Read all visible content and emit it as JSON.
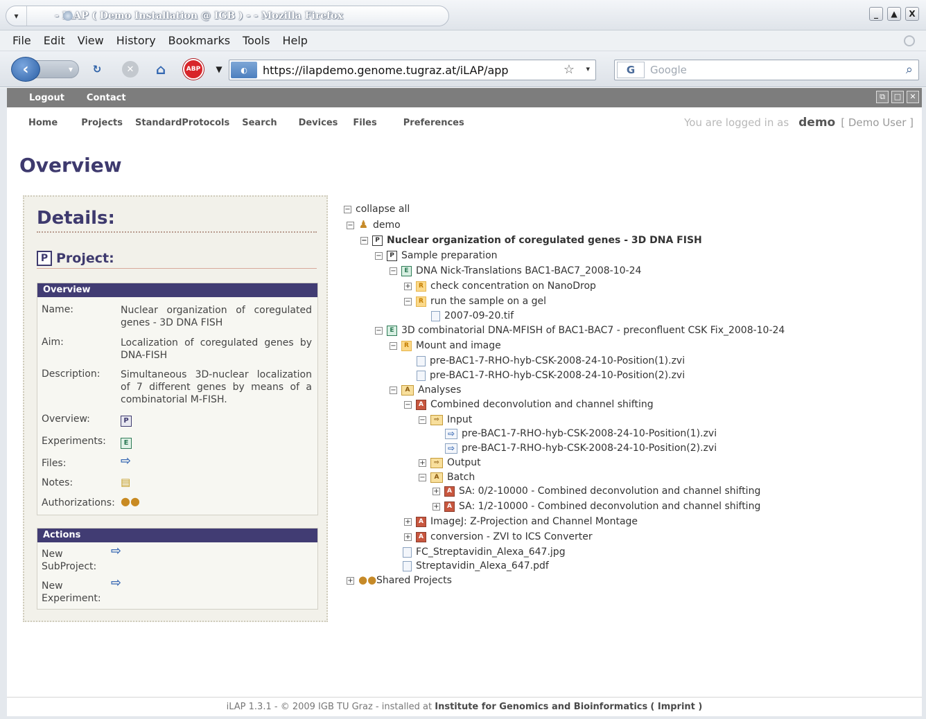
{
  "window": {
    "title": "- ILAP ( Demo Installation @ IGB ) - - Mozilla Firefox",
    "controls": [
      "_",
      "▲",
      "X"
    ]
  },
  "menubar": [
    "File",
    "Edit",
    "View",
    "History",
    "Bookmarks",
    "Tools",
    "Help"
  ],
  "navbar": {
    "url": "https://ilapdemo.genome.tugraz.at/iLAP/app",
    "search_placeholder": "Google",
    "search_engine": "G",
    "abp_label": "ABP"
  },
  "appbar": {
    "logout": "Logout",
    "contact": "Contact"
  },
  "mainnav": {
    "items": [
      "Home",
      "Projects",
      "StandardProtocols",
      "Search",
      "Devices",
      "Files",
      "Preferences"
    ],
    "login_prefix": "You are logged in as",
    "login_user": "demo",
    "login_name": "[ Demo User ]"
  },
  "page": {
    "title": "Overview"
  },
  "details": {
    "title": "Details:",
    "project_label": "Project:",
    "overview_header": "Overview",
    "fields": {
      "name_label": "Name:",
      "name_value": "Nuclear organization of coregulated genes - 3D DNA FISH",
      "aim_label": "Aim:",
      "aim_value": "Localization of coregulated genes by DNA-FISH",
      "description_label": "Description:",
      "description_value": "Simultaneous 3D-nuclear localization of 7 different genes by means of a combinatorial M-FISH.",
      "overview_label": "Overview:",
      "experiments_label": "Experiments:",
      "files_label": "Files:",
      "notes_label": "Notes:",
      "authorizations_label": "Authorizations:"
    },
    "actions_header": "Actions",
    "actions": {
      "new_subproject": "New SubProject:",
      "new_experiment": "New Experiment:"
    }
  },
  "tree": {
    "collapse_all": "collapse all",
    "nodes": [
      "demo",
      "Nuclear organization of coregulated genes - 3D DNA FISH",
      "Sample preparation",
      "DNA Nick-Translations BAC1-BAC7_2008-10-24",
      "check concentration on NanoDrop",
      "run the sample on a gel",
      "2007-09-20.tif",
      "3D combinatorial DNA-MFISH of BAC1-BAC7 - preconfluent CSK Fix_2008-10-24",
      "Mount and image",
      "pre-BAC1-7-RHO-hyb-CSK-2008-24-10-Position(1).zvi",
      "pre-BAC1-7-RHO-hyb-CSK-2008-24-10-Position(2).zvi",
      "Analyses",
      "Combined deconvolution and channel shifting",
      "Input",
      "pre-BAC1-7-RHO-hyb-CSK-2008-24-10-Position(1).zvi",
      "pre-BAC1-7-RHO-hyb-CSK-2008-24-10-Position(2).zvi",
      "Output",
      "Batch",
      "SA: 0/2-10000 - Combined deconvolution and channel shifting",
      "SA: 1/2-10000 - Combined deconvolution and channel shifting",
      "ImageJ: Z-Projection and Channel Montage",
      "conversion - ZVI to ICS Converter",
      "FC_Streptavidin_Alexa_647.jpg",
      "Streptavidin_Alexa_647.pdf",
      "Shared Projects"
    ]
  },
  "footer": {
    "prefix": "iLAP 1.3.1 - © 2009 IGB TU Graz - installed at",
    "institute": "Institute for Genomics and Bioinformatics",
    "imprint": "( Imprint )"
  },
  "colors": {
    "brand_purple": "#3e3a6e",
    "box_header": "#413c73",
    "appbar_gray": "#7d7d7d"
  }
}
